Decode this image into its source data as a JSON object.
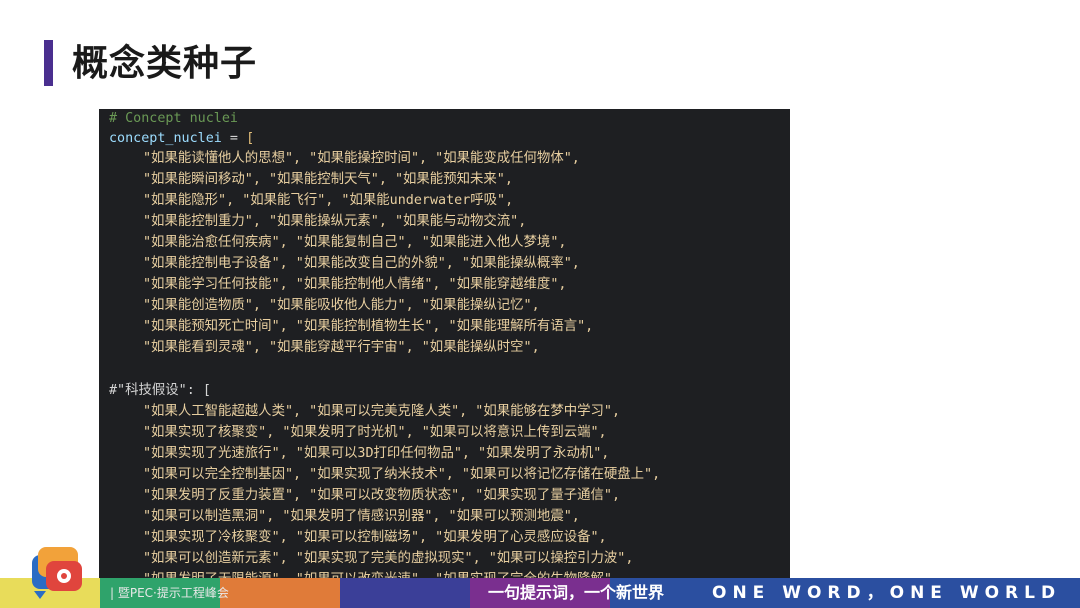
{
  "slide": {
    "title": "概念类种子"
  },
  "code": {
    "comment1": "# Concept nuclei",
    "var_line_var": "concept_nuclei",
    "var_line_eq": " = ",
    "var_line_bracket": "[",
    "group1": [
      "\"如果能读懂他人的思想\", \"如果能操控时间\", \"如果能变成任何物体\",",
      "\"如果能瞬间移动\", \"如果能控制天气\", \"如果能预知未来\",",
      "\"如果能隐形\", \"如果能飞行\", \"如果能underwater呼吸\",",
      "\"如果能控制重力\", \"如果能操纵元素\", \"如果能与动物交流\",",
      "\"如果能治愈任何疾病\", \"如果能复制自己\", \"如果能进入他人梦境\",",
      "\"如果能控制电子设备\", \"如果能改变自己的外貌\", \"如果能操纵概率\",",
      "\"如果能学习任何技能\", \"如果能控制他人情绪\", \"如果能穿越维度\",",
      "\"如果能创造物质\", \"如果能吸收他人能力\", \"如果能操纵记忆\",",
      "\"如果能预知死亡时间\", \"如果能控制植物生长\", \"如果能理解所有语言\",",
      "\"如果能看到灵魂\", \"如果能穿越平行宇宙\", \"如果能操纵时空\","
    ],
    "comment2": "#\"科技假设\": [",
    "group2": [
      "\"如果人工智能超越人类\", \"如果可以完美克隆人类\", \"如果能够在梦中学习\",",
      "\"如果实现了核聚变\", \"如果发明了时光机\", \"如果可以将意识上传到云端\",",
      "\"如果实现了光速旅行\", \"如果可以3D打印任何物品\", \"如果发明了永动机\",",
      "\"如果可以完全控制基因\", \"如果实现了纳米技术\", \"如果可以将记忆存储在硬盘上\",",
      "\"如果发明了反重力装置\", \"如果可以改变物质状态\", \"如果实现了量子通信\",",
      "\"如果可以制造黑洞\", \"如果发明了情感识别器\", \"如果可以预测地震\",",
      "\"如果实现了冷核聚变\", \"如果可以控制磁场\", \"如果发明了心灵感应设备\",",
      "\"如果可以创造新元素\", \"如果实现了完美的虚拟现实\", \"如果可以操控引力波\",",
      "\"如果发明了无限能源\", \"如果可以改变光速\", \"如果实现了完全的生物降解\""
    ]
  },
  "footer": {
    "left_text": "| 暨PEC·提示工程峰会",
    "slogan": "一句提示词，一个新世界",
    "motto": "ONE WORD，ONE WORLD"
  },
  "colors": {
    "accent": "#4a2f8f",
    "band": [
      "#e8dc5a",
      "#2fa36b",
      "#e07b39",
      "#3b3f98",
      "#7a2f8f",
      "#2b4fa0"
    ]
  }
}
